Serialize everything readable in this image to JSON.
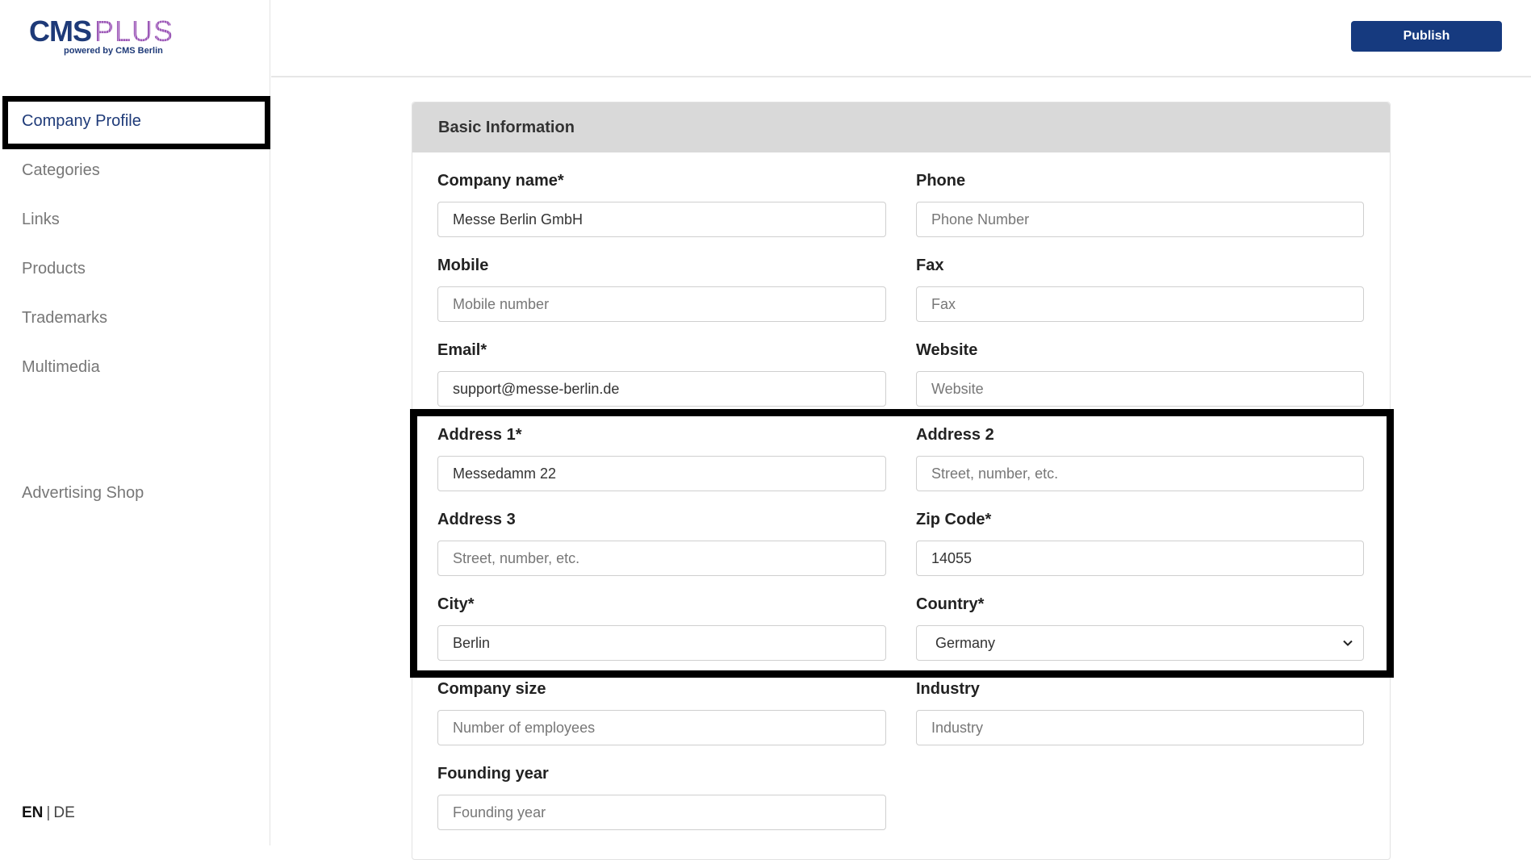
{
  "logo": {
    "main": "CMS",
    "plus": "PLUS",
    "sub": "powered by CMS Berlin"
  },
  "sidebar": {
    "items": [
      {
        "label": "Company Profile",
        "active": true
      },
      {
        "label": "Categories"
      },
      {
        "label": "Links"
      },
      {
        "label": "Products"
      },
      {
        "label": "Trademarks"
      },
      {
        "label": "Multimedia"
      },
      {
        "label": "Advertising Shop"
      }
    ],
    "lang": {
      "en": "EN",
      "sep": "|",
      "de": "DE"
    }
  },
  "header": {
    "publish_label": "Publish"
  },
  "card": {
    "title": "Basic Information",
    "fields": {
      "company_name": {
        "label": "Company name*",
        "value": "Messe Berlin GmbH",
        "placeholder": ""
      },
      "phone": {
        "label": "Phone",
        "value": "",
        "placeholder": "Phone Number"
      },
      "mobile": {
        "label": "Mobile",
        "value": "",
        "placeholder": "Mobile number"
      },
      "fax": {
        "label": "Fax",
        "value": "",
        "placeholder": "Fax"
      },
      "email": {
        "label": "Email*",
        "value": "support@messe-berlin.de",
        "placeholder": ""
      },
      "website": {
        "label": "Website",
        "value": "",
        "placeholder": "Website"
      },
      "address1": {
        "label": "Address 1*",
        "value": "Messedamm 22",
        "placeholder": ""
      },
      "address2": {
        "label": "Address 2",
        "value": "",
        "placeholder": "Street, number, etc."
      },
      "address3": {
        "label": "Address 3",
        "value": "",
        "placeholder": "Street, number, etc."
      },
      "zip": {
        "label": "Zip Code*",
        "value": "14055",
        "placeholder": ""
      },
      "city": {
        "label": "City*",
        "value": "Berlin",
        "placeholder": ""
      },
      "country": {
        "label": "Country*",
        "value": "Germany"
      },
      "company_size": {
        "label": "Company size",
        "value": "",
        "placeholder": "Number of employees"
      },
      "industry": {
        "label": "Industry",
        "value": "",
        "placeholder": "Industry"
      },
      "founding_year": {
        "label": "Founding year",
        "value": "",
        "placeholder": "Founding year"
      }
    }
  },
  "colors": {
    "brand": "#1e3a78",
    "publish_bg": "#163a7f",
    "card_header_bg": "#d9d9d9"
  }
}
